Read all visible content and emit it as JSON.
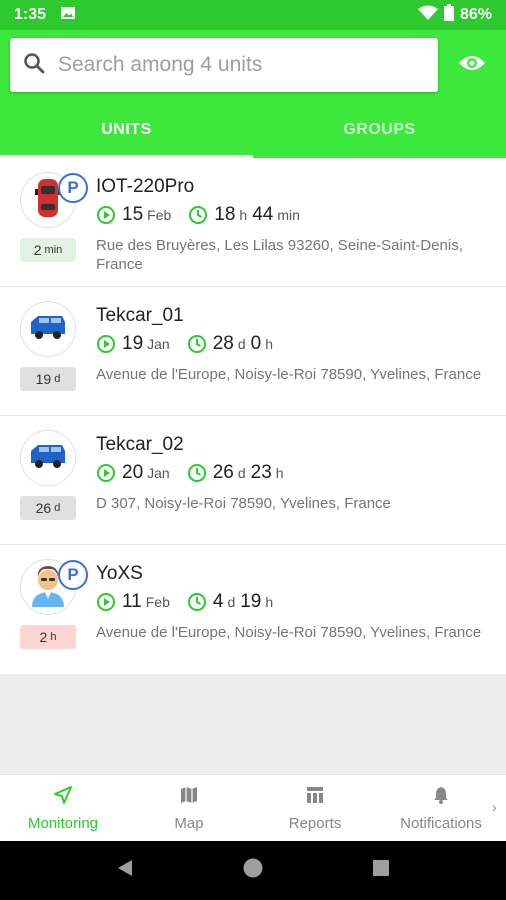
{
  "status_bar": {
    "time": "1:35",
    "battery": "86%"
  },
  "search": {
    "placeholder": "Search among 4 units"
  },
  "tabs": [
    {
      "label": "UNITS",
      "active": true
    },
    {
      "label": "GROUPS",
      "active": false
    }
  ],
  "units": [
    {
      "name": "IOT-220Pro",
      "icon": "red-car-icon",
      "parked": true,
      "badge_value": "2",
      "badge_unit": "min",
      "badge_color": "green",
      "date_day": "15",
      "date_month": "Feb",
      "dur_a": "18",
      "dur_a_unit": "h",
      "dur_b": "44",
      "dur_b_unit": "min",
      "address": "Rue des Bruyères, Les Lilas 93260, Seine-Saint-Denis, France"
    },
    {
      "name": "Tekcar_01",
      "icon": "blue-van-icon",
      "parked": false,
      "badge_value": "19",
      "badge_unit": "d",
      "badge_color": "gray",
      "date_day": "19",
      "date_month": "Jan",
      "dur_a": "28",
      "dur_a_unit": "d",
      "dur_b": "0",
      "dur_b_unit": "h",
      "address": "Avenue de l'Europe, Noisy-le-Roi 78590, Yvelines, France"
    },
    {
      "name": "Tekcar_02",
      "icon": "blue-van-icon",
      "parked": false,
      "badge_value": "26",
      "badge_unit": "d",
      "badge_color": "gray",
      "date_day": "20",
      "date_month": "Jan",
      "dur_a": "26",
      "dur_a_unit": "d",
      "dur_b": "23",
      "dur_b_unit": "h",
      "address": "D 307, Noisy-le-Roi 78590, Yvelines, France"
    },
    {
      "name": "YoXS",
      "icon": "person-icon",
      "parked": true,
      "badge_value": "2",
      "badge_unit": "h",
      "badge_color": "red",
      "date_day": "11",
      "date_month": "Feb",
      "dur_a": "4",
      "dur_a_unit": "d",
      "dur_b": "19",
      "dur_b_unit": "h",
      "address": "Avenue de l'Europe, Noisy-le-Roi 78590, Yvelines, France"
    }
  ],
  "bottom_nav": [
    {
      "label": "Monitoring",
      "icon": "navigation-arrow-icon",
      "active": true
    },
    {
      "label": "Map",
      "icon": "map-icon",
      "active": false
    },
    {
      "label": "Reports",
      "icon": "reports-icon",
      "active": false
    },
    {
      "label": "Notifications",
      "icon": "bell-icon",
      "active": false
    }
  ],
  "colors": {
    "accent": "#3de83d",
    "status_bar": "#2ec92e",
    "parking": "#3b6fd8"
  },
  "parking_label": "P"
}
